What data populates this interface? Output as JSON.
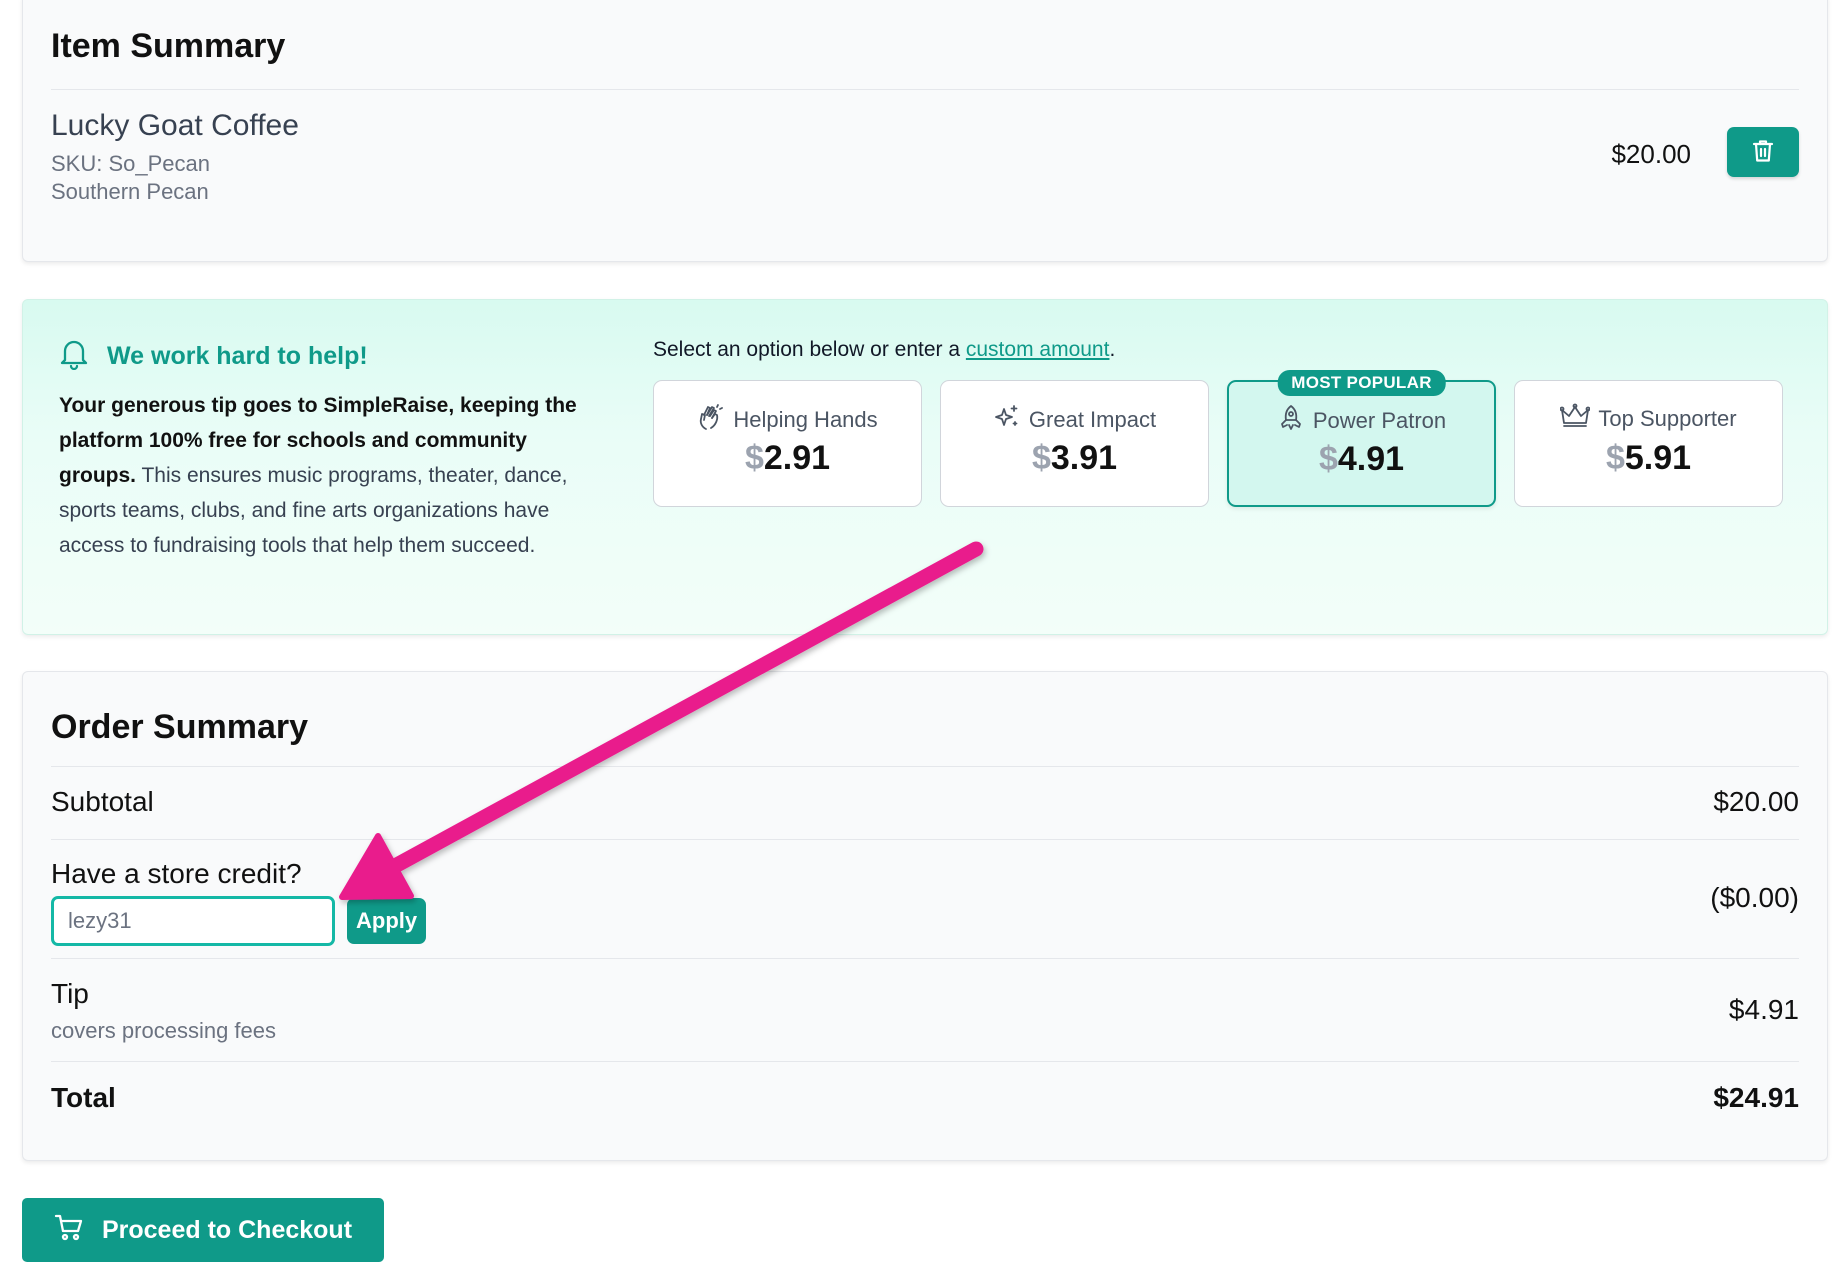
{
  "item_summary": {
    "title": "Item Summary",
    "item": {
      "name": "Lucky Goat Coffee",
      "sku": "SKU: So_Pecan",
      "variant": "Southern Pecan",
      "price": "$20.00"
    },
    "delete_icon": "trash-icon"
  },
  "tip": {
    "heading": "We work hard to help!",
    "body_bold": "Your generous tip goes to SimpleRaise, keeping the platform 100% free for schools and community groups.",
    "body_rest": " This ensures music programs, theater, dance, sports teams, clubs, and fine arts organizations have access to fundraising tools that help them succeed.",
    "prompt_before": "Select an option below or enter a ",
    "prompt_link": "custom amount",
    "prompt_after": ".",
    "options": [
      {
        "label": "Helping Hands",
        "currency": "$",
        "amount": "2.91",
        "icon": "clapping-hands-icon"
      },
      {
        "label": "Great Impact",
        "currency": "$",
        "amount": "3.91",
        "icon": "sparkle-icon"
      },
      {
        "label": "Power Patron",
        "currency": "$",
        "amount": "4.91",
        "icon": "rocket-icon",
        "badge": "MOST POPULAR",
        "selected": true
      },
      {
        "label": "Top Supporter",
        "currency": "$",
        "amount": "5.91",
        "icon": "crown-icon"
      }
    ]
  },
  "order_summary": {
    "title": "Order Summary",
    "subtotal_label": "Subtotal",
    "subtotal_value": "$20.00",
    "credit_label": "Have a store credit?",
    "credit_input_value": "lezy31",
    "apply_label": "Apply",
    "credit_value": "($0.00)",
    "tip_label": "Tip",
    "tip_sub": "covers processing fees",
    "tip_value": "$4.91",
    "total_label": "Total",
    "total_value": "$24.91"
  },
  "checkout": {
    "label": "Proceed to Checkout",
    "icon": "cart-icon"
  },
  "colors": {
    "accent": "#0f9a89",
    "annotation": "#e91e8c"
  }
}
